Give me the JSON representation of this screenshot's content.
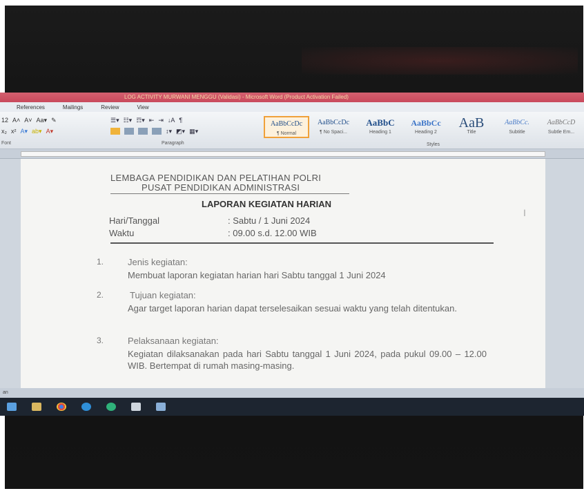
{
  "window": {
    "title": "LOG ACTIVITY MURWANI MENGGU (Validasi) - Microsoft Word (Product Activation Failed)"
  },
  "ribbon": {
    "tabs": [
      "References",
      "Mailings",
      "Review",
      "View"
    ],
    "font_group": {
      "font_size": "12",
      "label": "Font"
    },
    "paragraph_group": {
      "label": "Paragraph"
    },
    "styles_group": {
      "label": "Styles",
      "styles": [
        {
          "sample": "AaBbCcDc",
          "name": "¶ Normal"
        },
        {
          "sample": "AaBbCcDc",
          "name": "¶ No Spaci..."
        },
        {
          "sample": "AaBbC",
          "name": "Heading 1"
        },
        {
          "sample": "AaBbCc",
          "name": "Heading 2"
        },
        {
          "sample": "AaB",
          "name": "Title"
        },
        {
          "sample": "AaBbCc.",
          "name": "Subtitle"
        },
        {
          "sample": "AaBbCcD",
          "name": "Subtle Em..."
        }
      ]
    }
  },
  "document": {
    "header_line1": "LEMBAGA PENDIDIKAN DAN PELATIHAN POLRI",
    "header_line2": "PUSAT PENDIDIKAN ADMINISTRASI",
    "title": "LAPORAN KEGIATAN HARIAN",
    "meta": [
      {
        "label": "Hari/Tanggal",
        "value": ": Sabtu / 1 Juni 2024"
      },
      {
        "label": "Waktu",
        "value": ": 09.00 s.d. 12.00 WIB"
      }
    ],
    "items": [
      {
        "num": "1.",
        "heading": "Jenis kegiatan:",
        "body": "Membuat laporan kegiatan harian hari Sabtu tanggal 1 Juni 2024"
      },
      {
        "num": "2.",
        "heading": "Tujuan kegiatan:",
        "body": "Agar target laporan harian dapat terselesaikan sesuai waktu yang telah ditentukan."
      },
      {
        "num": "3.",
        "heading": "Pelaksanaan kegiatan:",
        "body": "Kegiatan dilaksanakan pada hari Sabtu tanggal 1 Juni 2024, pada pukul 09.00 – 12.00 WIB. Bertempat di rumah masing-masing."
      }
    ]
  },
  "statusbar": {
    "text": "an"
  }
}
